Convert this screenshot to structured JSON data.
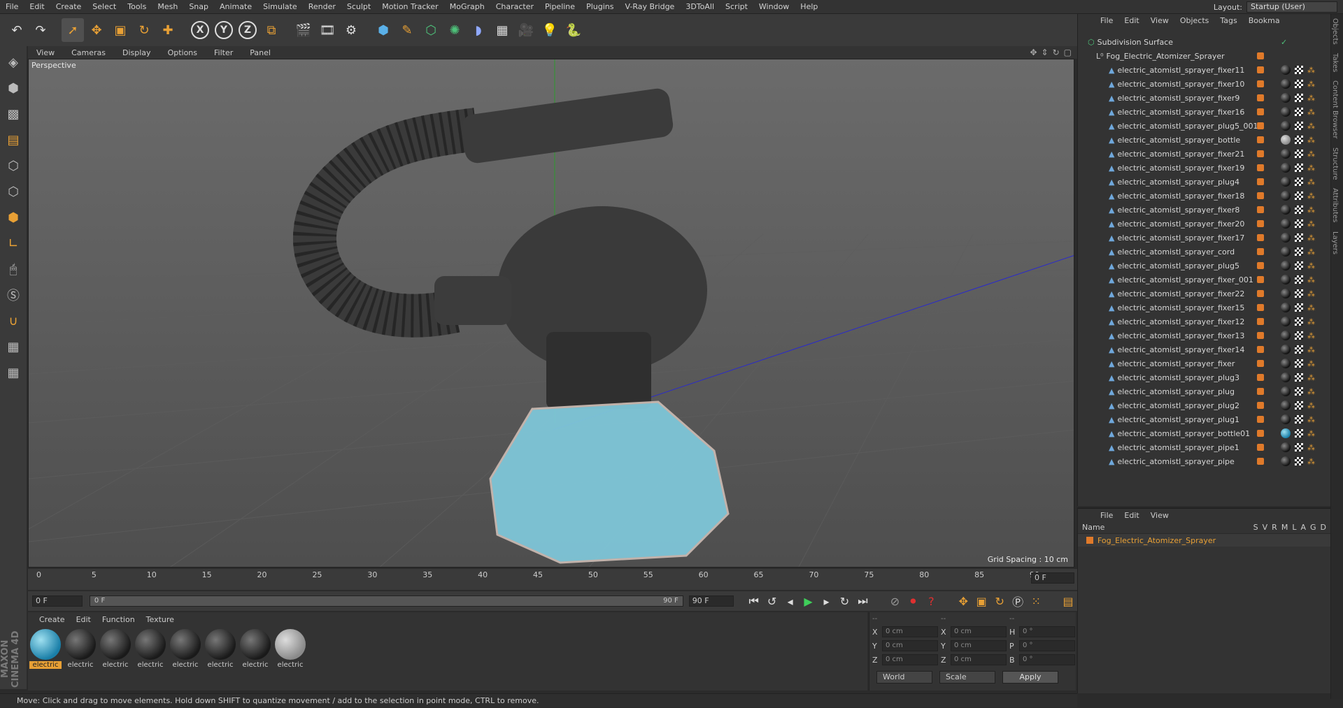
{
  "app": {
    "menus": [
      "File",
      "Edit",
      "Create",
      "Select",
      "Tools",
      "Mesh",
      "Snap",
      "Animate",
      "Simulate",
      "Render",
      "Sculpt",
      "Motion Tracker",
      "MoGraph",
      "Character",
      "Pipeline",
      "Plugins",
      "V-Ray Bridge",
      "3DToAll",
      "Script",
      "Window",
      "Help"
    ],
    "layout_label": "Layout:",
    "layout_value": "Startup (User)"
  },
  "viewport": {
    "menus": [
      "View",
      "Cameras",
      "Display",
      "Options",
      "Filter",
      "Panel"
    ],
    "label": "Perspective",
    "grid_spacing": "Grid Spacing : 10 cm"
  },
  "timeline": {
    "ticks": [
      "0",
      "5",
      "10",
      "15",
      "20",
      "25",
      "30",
      "35",
      "40",
      "45",
      "50",
      "55",
      "60",
      "65",
      "70",
      "75",
      "80",
      "85",
      "90"
    ],
    "frame": "0 F",
    "start": "0 F",
    "range_start": "0 F",
    "range_end": "90 F",
    "end": "90 F"
  },
  "materials": {
    "menus": [
      "Create",
      "Edit",
      "Function",
      "Texture"
    ],
    "items": [
      "electric",
      "electric",
      "electric",
      "electric",
      "electric",
      "electric",
      "electric",
      "electric"
    ]
  },
  "coords": {
    "headers": [
      "--",
      "--",
      "--"
    ],
    "rows": [
      {
        "l1": "X",
        "v1": "0 cm",
        "l2": "X",
        "v2": "0 cm",
        "l3": "H",
        "v3": "0 °"
      },
      {
        "l1": "Y",
        "v1": "0 cm",
        "l2": "Y",
        "v2": "0 cm",
        "l3": "P",
        "v3": "0 °"
      },
      {
        "l1": "Z",
        "v1": "0 cm",
        "l2": "Z",
        "v2": "0 cm",
        "l3": "B",
        "v3": "0 °"
      }
    ],
    "world": "World",
    "scale": "Scale",
    "apply": "Apply"
  },
  "objects": {
    "menus": [
      "File",
      "Edit",
      "View",
      "Objects",
      "Tags",
      "Bookma"
    ],
    "root": "Subdivision Surface",
    "group": "Fog_Electric_Atomizer_Sprayer",
    "items": [
      "electric_atomistl_sprayer_fixer11",
      "electric_atomistl_sprayer_fixer10",
      "electric_atomistl_sprayer_fixer9",
      "electric_atomistl_sprayer_fixer16",
      "electric_atomistl_sprayer_plug5_001",
      "electric_atomistl_sprayer_bottle",
      "electric_atomistl_sprayer_fixer21",
      "electric_atomistl_sprayer_fixer19",
      "electric_atomistl_sprayer_plug4",
      "electric_atomistl_sprayer_fixer18",
      "electric_atomistl_sprayer_fixer8",
      "electric_atomistl_sprayer_fixer20",
      "electric_atomistl_sprayer_fixer17",
      "electric_atomistl_sprayer_cord",
      "electric_atomistl_sprayer_plug5",
      "electric_atomistl_sprayer_fixer_001",
      "electric_atomistl_sprayer_fixer22",
      "electric_atomistl_sprayer_fixer15",
      "electric_atomistl_sprayer_fixer12",
      "electric_atomistl_sprayer_fixer13",
      "electric_atomistl_sprayer_fixer14",
      "electric_atomistl_sprayer_fixer",
      "electric_atomistl_sprayer_plug3",
      "electric_atomistl_sprayer_plug",
      "electric_atomistl_sprayer_plug2",
      "electric_atomistl_sprayer_plug1",
      "electric_atomistl_sprayer_bottle01",
      "electric_atomistl_sprayer_pipe1",
      "electric_atomistl_sprayer_pipe"
    ]
  },
  "layers": {
    "menus": [
      "File",
      "Edit",
      "View"
    ],
    "name_header": "Name",
    "cols": [
      "S",
      "V",
      "R",
      "M",
      "L",
      "A",
      "G",
      "D"
    ],
    "row": "Fog_Electric_Atomizer_Sprayer"
  },
  "side_tabs": [
    "Objects",
    "Takes",
    "Content Browser",
    "Structure",
    "Attributes",
    "Layers"
  ],
  "status": "Move: Click and drag to move elements. Hold down SHIFT to quantize movement / add to the selection in point mode, CTRL to remove.",
  "brand": "MAXON CINEMA 4D"
}
